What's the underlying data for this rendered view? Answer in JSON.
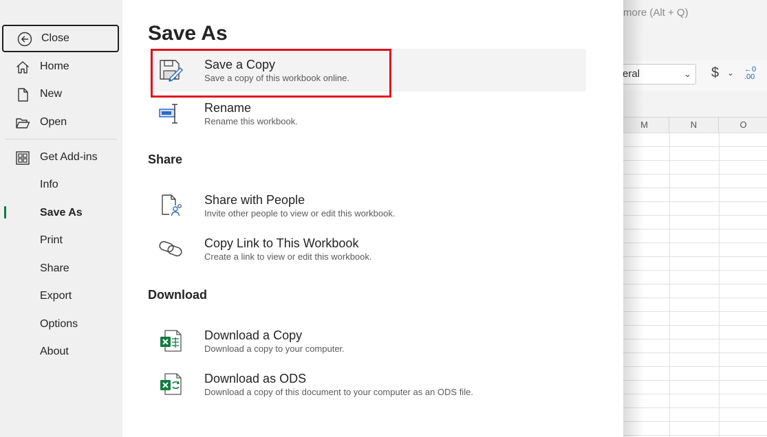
{
  "background": {
    "search_text": "more (Alt + Q)",
    "number_format": "eral",
    "currency_symbol": "$",
    "decimal_top": "←0",
    "decimal_bottom": ".00",
    "columns": [
      "M",
      "N",
      "O"
    ]
  },
  "nav": {
    "close": "Close",
    "items": [
      {
        "label": "Home",
        "icon": "home-icon"
      },
      {
        "label": "New",
        "icon": "new-file-icon"
      },
      {
        "label": "Open",
        "icon": "open-folder-icon"
      },
      {
        "label": "Get Add-ins",
        "icon": "add-ins-icon"
      },
      {
        "label": "Info"
      },
      {
        "label": "Save As",
        "active": true
      },
      {
        "label": "Print"
      },
      {
        "label": "Share"
      },
      {
        "label": "Export"
      },
      {
        "label": "Options"
      },
      {
        "label": "About"
      }
    ]
  },
  "main": {
    "title": "Save As",
    "save_options": [
      {
        "title": "Save a Copy",
        "desc": "Save a copy of this workbook online.",
        "icon": "save-copy-icon"
      },
      {
        "title": "Rename",
        "desc": "Rename this workbook.",
        "icon": "rename-icon"
      }
    ],
    "share_heading": "Share",
    "share_options": [
      {
        "title": "Share with People",
        "desc": "Invite other people to view or edit this workbook.",
        "icon": "share-people-icon"
      },
      {
        "title": "Copy Link to This Workbook",
        "desc": "Create a link to view or edit this workbook.",
        "icon": "link-icon"
      }
    ],
    "download_heading": "Download",
    "download_options": [
      {
        "title": "Download a Copy",
        "desc": "Download a copy to your computer.",
        "icon": "excel-download-icon"
      },
      {
        "title": "Download as ODS",
        "desc": "Download a copy of this document to your computer as an ODS file.",
        "icon": "excel-ods-icon"
      }
    ]
  },
  "colors": {
    "accent": "#107c41",
    "highlight_border": "#e0111b",
    "nav_bg": "#f0f0f0"
  }
}
